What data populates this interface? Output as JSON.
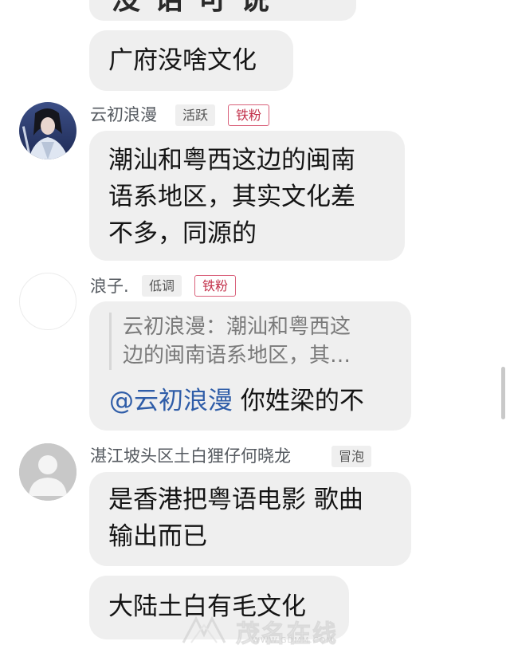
{
  "top_message": {
    "partial_text": "没话可说"
  },
  "messages": [
    {
      "id": "m1",
      "lines": [
        "广府没啥文化"
      ]
    },
    {
      "id": "m2",
      "user": {
        "name": "云初浪漫",
        "badges": [
          "活跃",
          "铁粉"
        ]
      },
      "lines": [
        "潮汕和粤西这边的闽南",
        "语系地区，其实文化差",
        "不多，同源的"
      ]
    },
    {
      "id": "m3",
      "user": {
        "name": "浪子.",
        "badges": [
          "低调",
          "铁粉"
        ]
      },
      "quote": {
        "lines": [
          "云初浪漫：潮汕和粤西这",
          "边的闽南语系地区，其…"
        ]
      },
      "mention": "@云初浪漫",
      "text": " 你姓梁的不"
    },
    {
      "id": "m4",
      "user": {
        "name": "湛江坡头区土白狸仔何晓龙",
        "badges": [
          "冒泡"
        ]
      },
      "lines": [
        "是香港把粤语电影 歌曲",
        "输出而已"
      ]
    },
    {
      "id": "m5",
      "lines": [
        "大陆土白有毛文化"
      ]
    }
  ],
  "watermark": {
    "text": "茂名在线",
    "url": "WWW.GDMM.COM"
  },
  "colors": {
    "bubble": "#efefef",
    "username": "#555a60",
    "badge_red": "#c2304a",
    "mention": "#2f5da8",
    "quote_text": "#7a7a7a"
  }
}
